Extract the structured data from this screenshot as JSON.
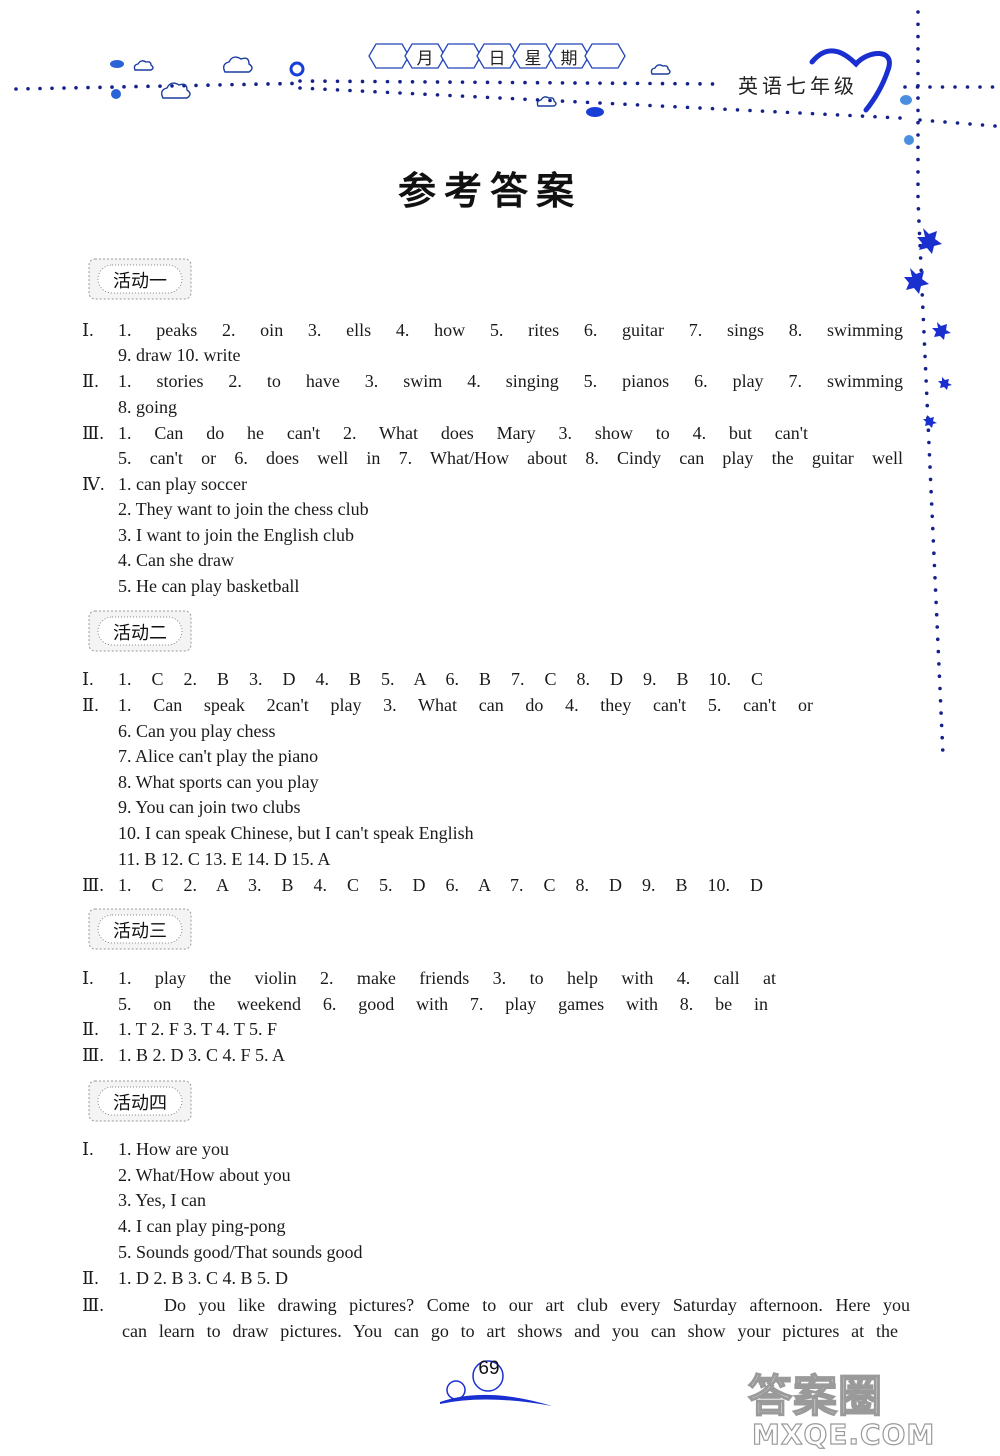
{
  "header": {
    "date_fields": [
      "",
      "月",
      "",
      "日",
      "星",
      "期",
      ""
    ],
    "subject": "英语七年级"
  },
  "title": "参考答案",
  "sections": [
    {
      "badge": "活动一",
      "lines": [
        {
          "roman": "Ⅰ.",
          "text": "1. peaks 2. oin 3. ells 4. how 5. rites 6. guitar 7. sings 8. swimming"
        },
        {
          "roman": "",
          "text": "9. draw 10. write"
        },
        {
          "roman": "Ⅱ.",
          "text": "1. stories 2. to have 3. swim 4. singing 5. pianos 6. play 7. swimming"
        },
        {
          "roman": "",
          "text": "8. going"
        },
        {
          "roman": "Ⅲ.",
          "text": "1. Can do he can't 2. What does Mary 3. show to 4. but can't"
        },
        {
          "roman": "",
          "text": "5. can't or 6. does well in 7. What/How about 8. Cindy can play the guitar well"
        },
        {
          "roman": "Ⅳ.",
          "text": "1. can play soccer"
        },
        {
          "roman": "",
          "text": "2. They want to join the chess club"
        },
        {
          "roman": "",
          "text": "3. I want to join the English club"
        },
        {
          "roman": "",
          "text": "4. Can she draw"
        },
        {
          "roman": "",
          "text": "5. He can play basketball"
        }
      ]
    },
    {
      "badge": "活动二",
      "lines": [
        {
          "roman": "Ⅰ.",
          "text": "1. C 2. B 3. D 4. B 5. A 6. B 7. C 8. D 9. B 10. C"
        },
        {
          "roman": "Ⅱ.",
          "text": "1. Can speak 2can't play 3. What can do 4. they can't 5. can't or"
        },
        {
          "roman": "",
          "text": "6. Can you play chess"
        },
        {
          "roman": "",
          "text": "7. Alice can't play the piano"
        },
        {
          "roman": "",
          "text": "8. What sports can you play"
        },
        {
          "roman": "",
          "text": "9. You can join two clubs"
        },
        {
          "roman": "",
          "text": "10. I can speak Chinese, but I can't speak English"
        },
        {
          "roman": "",
          "text": "11. B 12. C 13. E 14. D 15. A"
        },
        {
          "roman": "Ⅲ.",
          "text": "1. C 2. A 3. B 4. C 5. D 6. A 7. C 8. D 9. B 10. D"
        }
      ]
    },
    {
      "badge": "活动三",
      "lines": [
        {
          "roman": "Ⅰ.",
          "text": "1. play the violin 2. make friends 3. to help with 4. call at"
        },
        {
          "roman": "",
          "text": "5. on the weekend 6. good with 7. play games with 8. be in"
        },
        {
          "roman": "Ⅱ.",
          "text": "1. T 2. F 3. T 4. T 5. F"
        },
        {
          "roman": "Ⅲ.",
          "text": "1. B 2. D 3. C 4. F 5. A"
        }
      ]
    },
    {
      "badge": "活动四",
      "lines": [
        {
          "roman": "Ⅰ.",
          "text": "1. How are you"
        },
        {
          "roman": "",
          "text": "2. What/How about you"
        },
        {
          "roman": "",
          "text": "3. Yes, I can"
        },
        {
          "roman": "",
          "text": "4. I can play ping-pong"
        },
        {
          "roman": "",
          "text": "5. Sounds good/That sounds good"
        },
        {
          "roman": "Ⅱ.",
          "text": "1. D 2. B 3. C 4. B 5. D"
        },
        {
          "roman": "Ⅲ.",
          "text": "Do you like drawing pictures? Come to our art club every Saturday afternoon. Here you"
        },
        {
          "roman": "",
          "text": "can learn to draw pictures. You can go to art shows and you can show your pictures at the"
        }
      ]
    }
  ],
  "footer": {
    "page_number": "69",
    "watermark_top": "答案圈",
    "watermark_bottom": "MXQE.COM"
  },
  "colors": {
    "accent_blue": "#1a2fd0",
    "dot_navy": "#14218a"
  }
}
